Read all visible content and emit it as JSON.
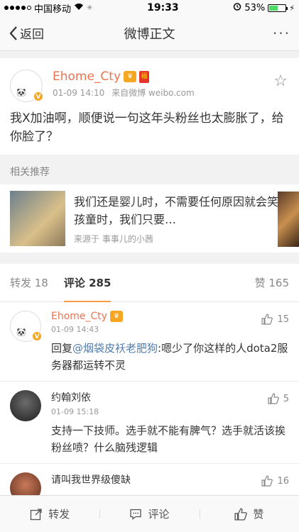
{
  "status": {
    "carrier": "中国移动",
    "time": "19:33",
    "battery": "53%",
    "battery_level": 0.53
  },
  "nav": {
    "back": "返回",
    "title": "微博正文",
    "more": "···"
  },
  "post": {
    "username": "Ehome_Cty",
    "time": "01-09 14:10",
    "source": "来自微博 weibo.com",
    "text": "我X加油啊，顺便说一句这年头粉丝也太膨胀了，给你脸了？"
  },
  "recommend": {
    "label": "相关推荐",
    "title": "我们还是婴儿时，不需要任何原因就会笑；孩童时，我们只要…",
    "source": "来源于 事事儿的小茜"
  },
  "tabs": {
    "repost": "转发 18",
    "comment": "评论 285",
    "like": "赞 165"
  },
  "comments": [
    {
      "name": "Ehome_Cty",
      "time": "01-09 14:43",
      "prefix": "回复",
      "mention": "@烟袋皮袄老肥狗",
      "text": ":嗯少了你这样的人dota2服务器都运转不灵",
      "likes": "15"
    },
    {
      "name": "约翰刘依",
      "time": "01-09 15:18",
      "text": "支持一下技师。选手就不能有脾气？选手就活该挨粉丝喷？什么脑残逻辑",
      "likes": "5"
    },
    {
      "name": "请叫我世界级傻缺",
      "likes": "16"
    }
  ],
  "bottom": {
    "repost": "转发",
    "comment": "评论",
    "like": "赞"
  },
  "colors": {
    "username": "#eb7350",
    "mention": "#507daf",
    "tab_underline": "#f79c40"
  }
}
